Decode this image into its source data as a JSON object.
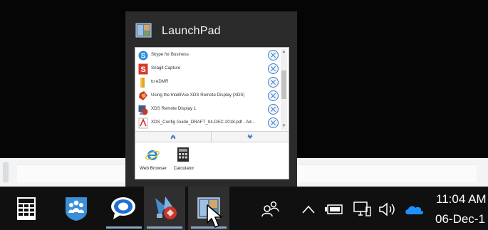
{
  "launchpad": {
    "title": "LaunchPad",
    "items": [
      {
        "label": "Skype for Business",
        "icon": "skype-icon"
      },
      {
        "label": "Snagit Capture",
        "icon": "snagit-icon"
      },
      {
        "label": "to eDMR",
        "icon": "folder-icon"
      },
      {
        "label": "Using the IntelliVue XDS Remote Display (XDS)",
        "icon": "pdf-document-icon"
      },
      {
        "label": "XDS Remote Display 1",
        "icon": "xds-remote-display-icon"
      },
      {
        "label": "XDS_Config Guide_DRAFT_04-DEC-2018.pdf - Ad...",
        "icon": "pdf-file-icon"
      }
    ],
    "apps": [
      {
        "label": "Web Browser",
        "icon": "internet-explorer-icon"
      },
      {
        "label": "Calculator",
        "icon": "calculator-icon"
      }
    ]
  },
  "taskbar": {
    "pinned": [
      {
        "name": "calculator",
        "icon": "calculator-icon"
      },
      {
        "name": "people-app",
        "icon": "people-group-icon"
      },
      {
        "name": "chat-app",
        "icon": "chat-bubble-icon"
      },
      {
        "name": "xds-app",
        "icon": "xds-icon"
      },
      {
        "name": "launchpad",
        "icon": "launchpad-icon"
      }
    ],
    "tray_icons": [
      "people-icon",
      "chevron-up-icon",
      "battery-icon",
      "network-icon",
      "volume-icon",
      "onedrive-cloud-icon"
    ],
    "clock_time": "11:04 AM",
    "clock_date": "06-Dec-1"
  },
  "colors": {
    "taskbar": "#101010",
    "popup": "#2b2b2b",
    "accent_blue": "#3c7bbf",
    "onedrive": "#1e90ff"
  }
}
